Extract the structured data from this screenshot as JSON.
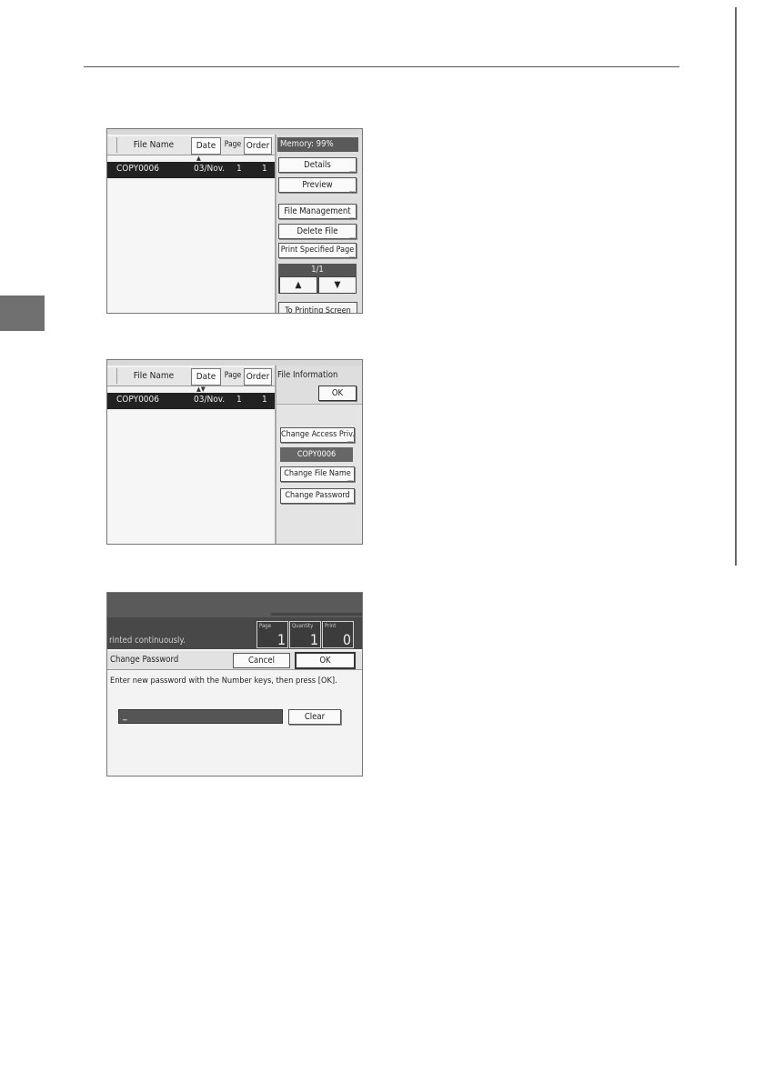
{
  "shot1": {
    "columns": {
      "file_name": "File Name",
      "date": "Date",
      "page": "Page",
      "order": "Order"
    },
    "sort_indicator": "▲",
    "row": {
      "name": "COPY0006",
      "date": "03/Nov.",
      "page": "1",
      "order": "1"
    },
    "memory": "Memory:  99%",
    "buttons": {
      "details": "Details",
      "preview": "Preview",
      "file_management": "File Management",
      "delete_file": "Delete File",
      "print_specified_page": "Print Specified Page"
    },
    "pager": {
      "label": "1/1",
      "up": "▲",
      "down": "▼"
    },
    "printing_screen": "To Printing Screen"
  },
  "shot2": {
    "columns": {
      "file_name": "File Name",
      "date": "Date",
      "page": "Page",
      "order": "Order"
    },
    "sort_indicator": "▲▼",
    "row": {
      "name": "COPY0006",
      "date": "03/Nov.",
      "page": "1",
      "order": "1"
    },
    "panel_title": "File Information",
    "ok": "OK",
    "buttons": {
      "change_access": "Change Access Priv.",
      "change_file_name": "Change File Name",
      "change_password": "Change Password"
    },
    "file_name_tag": "COPY0006"
  },
  "shot3": {
    "status_text": "rinted continuously.",
    "counters": [
      {
        "label": "Page",
        "value": "1"
      },
      {
        "label": "Quantity",
        "value": "1"
      },
      {
        "label": "Print",
        "value": "0"
      }
    ],
    "title": "Change Password",
    "cancel": "Cancel",
    "ok": "OK",
    "instruction": "Enter new password with the Number keys, then press [OK].",
    "input_value": "_",
    "clear": "Clear"
  },
  "ellipsis": "..."
}
